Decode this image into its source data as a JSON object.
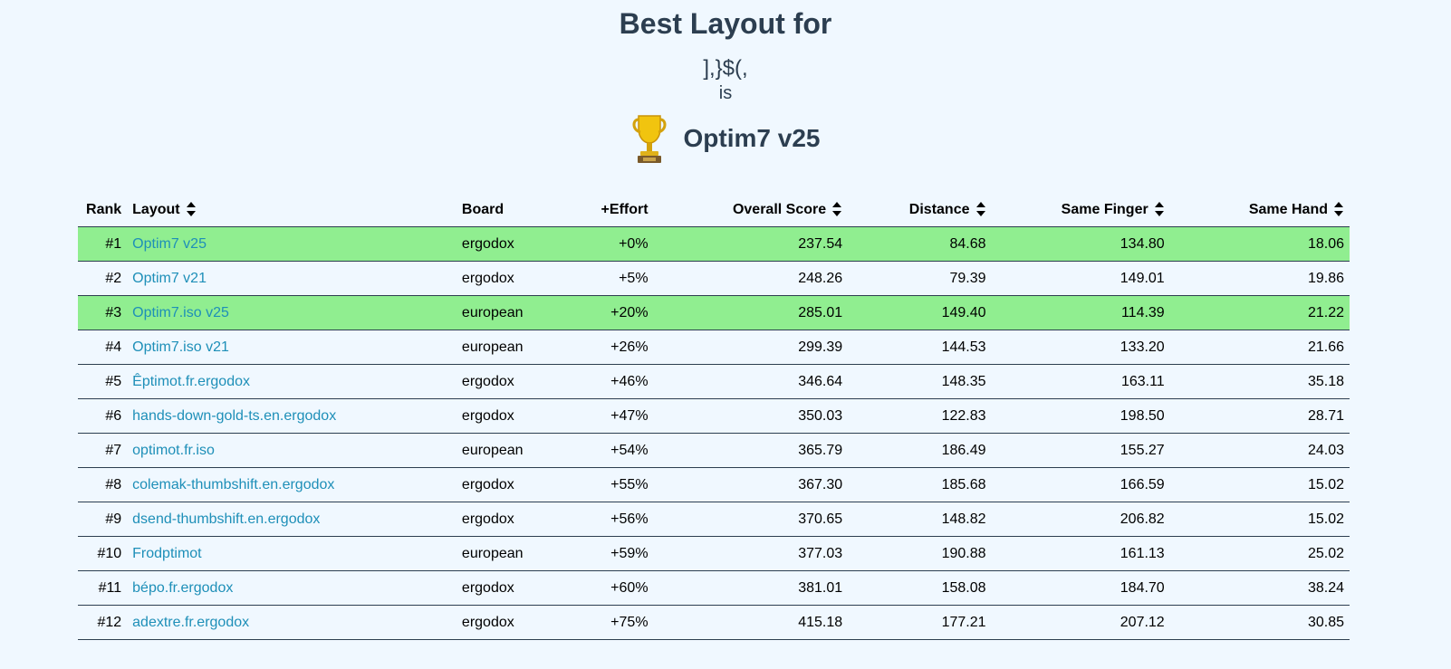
{
  "header": {
    "title": "Best Layout for",
    "characters": "],}$(,",
    "is_word": "is",
    "winner_icon": "trophy-icon",
    "winner_name": "Optim7 v25"
  },
  "table": {
    "columns": {
      "rank": "Rank",
      "layout": "Layout",
      "board": "Board",
      "effort": "+Effort",
      "overall": "Overall Score",
      "distance": "Distance",
      "same_finger": "Same Finger",
      "same_hand": "Same Hand"
    },
    "sortable_icon": "sort-updown-icon",
    "highlight_color": "#90ee90",
    "rows": [
      {
        "rank": "#1",
        "layout": "Optim7 v25",
        "board": "ergodox",
        "effort": "+0%",
        "overall": "237.54",
        "distance": "84.68",
        "same_finger": "134.80",
        "same_hand": "18.06",
        "highlight": true
      },
      {
        "rank": "#2",
        "layout": "Optim7 v21",
        "board": "ergodox",
        "effort": "+5%",
        "overall": "248.26",
        "distance": "79.39",
        "same_finger": "149.01",
        "same_hand": "19.86",
        "highlight": false
      },
      {
        "rank": "#3",
        "layout": "Optim7.iso v25",
        "board": "european",
        "effort": "+20%",
        "overall": "285.01",
        "distance": "149.40",
        "same_finger": "114.39",
        "same_hand": "21.22",
        "highlight": true
      },
      {
        "rank": "#4",
        "layout": "Optim7.iso v21",
        "board": "european",
        "effort": "+26%",
        "overall": "299.39",
        "distance": "144.53",
        "same_finger": "133.20",
        "same_hand": "21.66",
        "highlight": false
      },
      {
        "rank": "#5",
        "layout": "Êptimot.fr.ergodox",
        "board": "ergodox",
        "effort": "+46%",
        "overall": "346.64",
        "distance": "148.35",
        "same_finger": "163.11",
        "same_hand": "35.18",
        "highlight": false
      },
      {
        "rank": "#6",
        "layout": "hands-down-gold-ts.en.ergodox",
        "board": "ergodox",
        "effort": "+47%",
        "overall": "350.03",
        "distance": "122.83",
        "same_finger": "198.50",
        "same_hand": "28.71",
        "highlight": false
      },
      {
        "rank": "#7",
        "layout": "optimot.fr.iso",
        "board": "european",
        "effort": "+54%",
        "overall": "365.79",
        "distance": "186.49",
        "same_finger": "155.27",
        "same_hand": "24.03",
        "highlight": false
      },
      {
        "rank": "#8",
        "layout": "colemak-thumbshift.en.ergodox",
        "board": "ergodox",
        "effort": "+55%",
        "overall": "367.30",
        "distance": "185.68",
        "same_finger": "166.59",
        "same_hand": "15.02",
        "highlight": false
      },
      {
        "rank": "#9",
        "layout": "dsend-thumbshift.en.ergodox",
        "board": "ergodox",
        "effort": "+56%",
        "overall": "370.65",
        "distance": "148.82",
        "same_finger": "206.82",
        "same_hand": "15.02",
        "highlight": false
      },
      {
        "rank": "#10",
        "layout": "Frodptimot",
        "board": "european",
        "effort": "+59%",
        "overall": "377.03",
        "distance": "190.88",
        "same_finger": "161.13",
        "same_hand": "25.02",
        "highlight": false
      },
      {
        "rank": "#11",
        "layout": "bépo.fr.ergodox",
        "board": "ergodox",
        "effort": "+60%",
        "overall": "381.01",
        "distance": "158.08",
        "same_finger": "184.70",
        "same_hand": "38.24",
        "highlight": false
      },
      {
        "rank": "#12",
        "layout": "adextre.fr.ergodox",
        "board": "ergodox",
        "effort": "+75%",
        "overall": "415.18",
        "distance": "177.21",
        "same_finger": "207.12",
        "same_hand": "30.85",
        "highlight": false
      }
    ]
  }
}
